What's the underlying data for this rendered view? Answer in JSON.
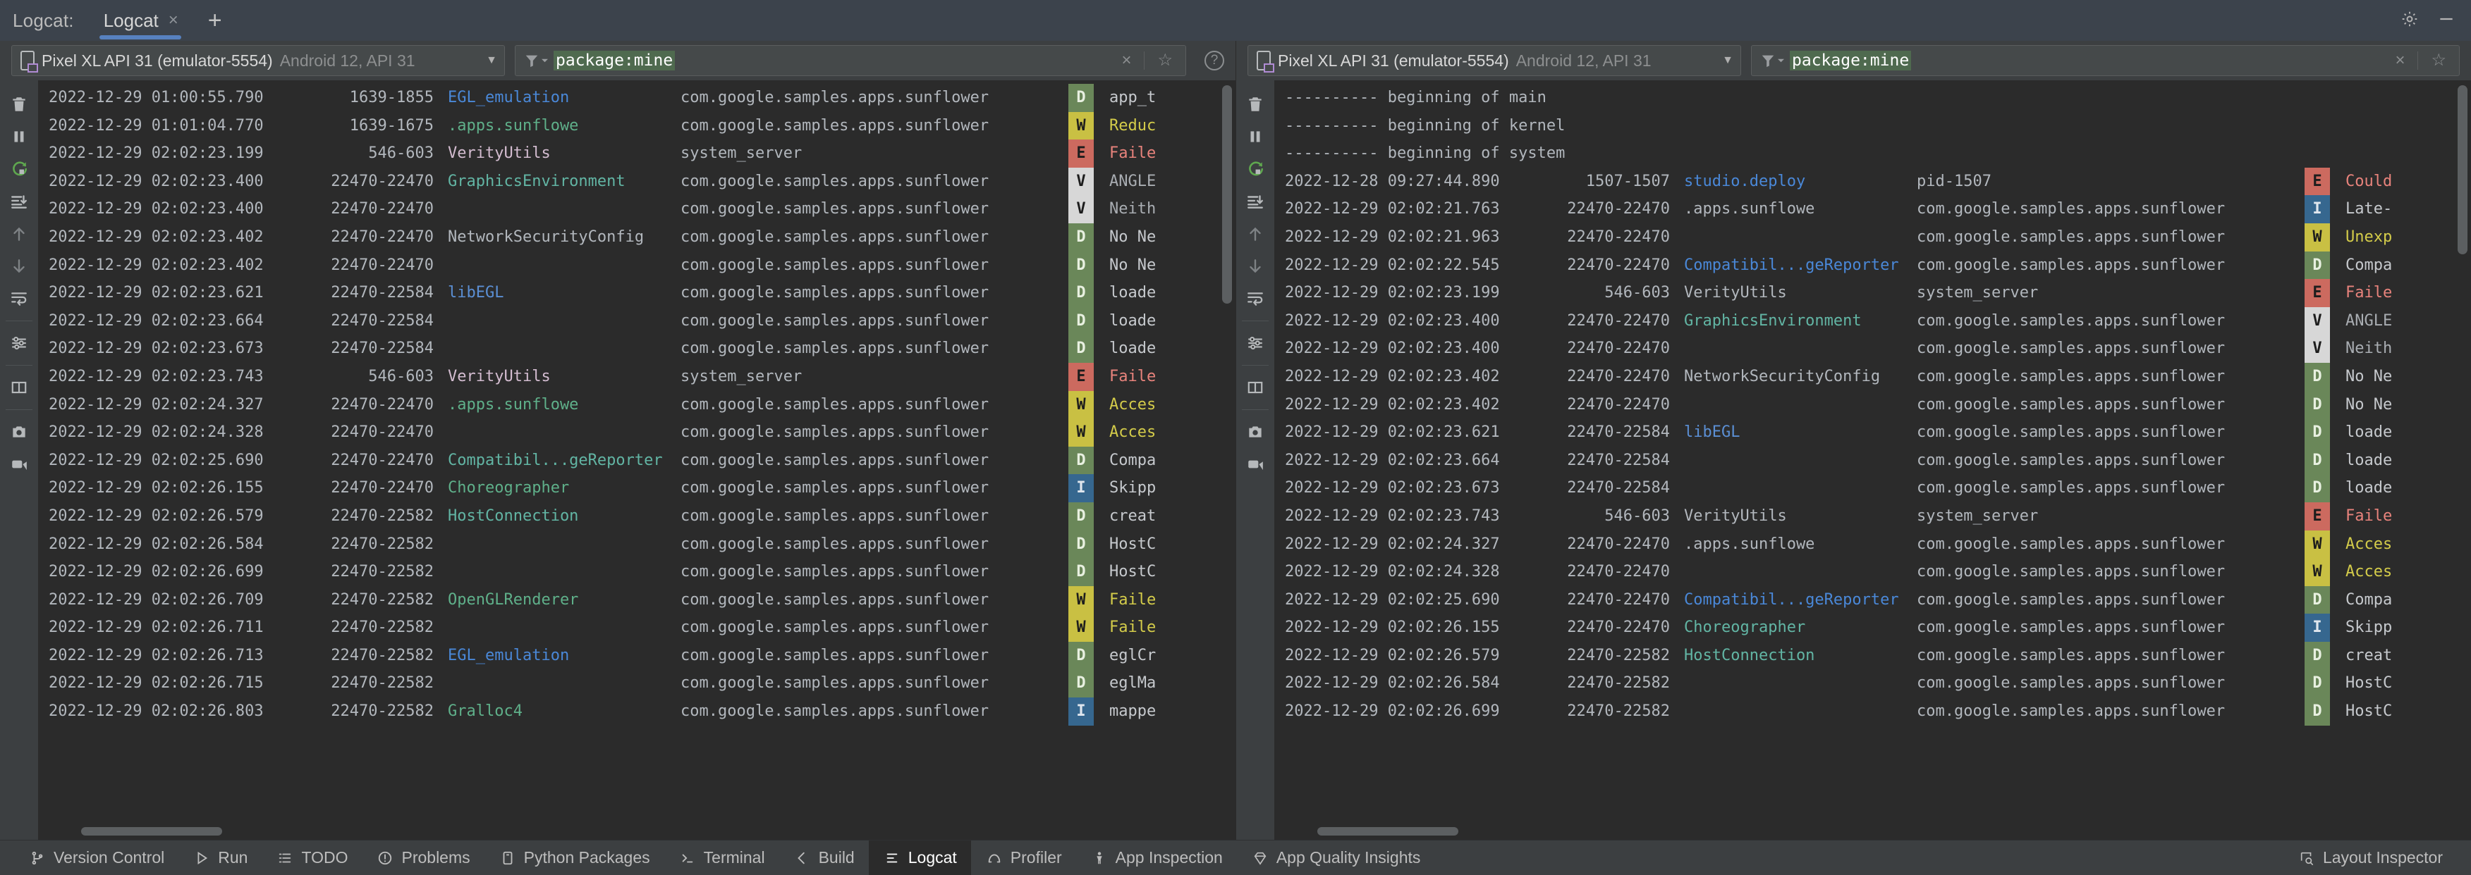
{
  "window": {
    "tab_label": "Logcat:",
    "tabs": [
      {
        "title": "Logcat",
        "close": "×",
        "active": true
      }
    ],
    "add_tab": "+",
    "settings_icon": "gear-icon",
    "minimize_icon": "minimize-icon"
  },
  "panels": [
    {
      "id": "left",
      "device": {
        "name": "Pixel XL API 31 (emulator-5554)",
        "meta": "Android 12, API 31",
        "caret": "▼"
      },
      "filter": {
        "query": "package:mine",
        "clear": "×",
        "favorite": "☆",
        "help": "?"
      },
      "toolbar": [
        "clear-logcat-icon",
        "pause-icon",
        "restart-icon",
        "scroll-to-end-icon",
        "previous-icon",
        "next-icon",
        "soft-wrap-icon",
        "configure-icon",
        "split-panels-icon",
        "screenshot-icon",
        "screen-record-icon"
      ],
      "rows": [
        {
          "ts": "2022-12-29 01:00:55.790",
          "pid": "1639-1855",
          "tag": "EGL_emulation",
          "tagcolor": "tag-blue",
          "pkg": "com.google.samples.apps.sunflower",
          "level": "D",
          "msg": "app_t"
        },
        {
          "ts": "2022-12-29 01:01:04.770",
          "pid": "1639-1675",
          "tag": ".apps.sunflowe",
          "tagcolor": "tag-green",
          "pkg": "com.google.samples.apps.sunflower",
          "level": "W",
          "msg": "Reduc"
        },
        {
          "ts": "2022-12-29 02:02:23.199",
          "pid": "546-603",
          "tag": "VerityUtils",
          "tagcolor": "tag-pink",
          "pkg": "system_server",
          "level": "E",
          "msg": "Faile"
        },
        {
          "ts": "2022-12-29 02:02:23.400",
          "pid": "22470-22470",
          "tag": "GraphicsEnvironment",
          "tagcolor": "tag-teal",
          "pkg": "com.google.samples.apps.sunflower",
          "level": "V",
          "msg": "ANGLE"
        },
        {
          "ts": "2022-12-29 02:02:23.400",
          "pid": "22470-22470",
          "tag": "",
          "tagcolor": "tag-gray",
          "pkg": "com.google.samples.apps.sunflower",
          "level": "V",
          "msg": "Neith"
        },
        {
          "ts": "2022-12-29 02:02:23.402",
          "pid": "22470-22470",
          "tag": "NetworkSecurityConfig",
          "tagcolor": "tag-gray",
          "pkg": "com.google.samples.apps.sunflower",
          "level": "D",
          "msg": "No Ne"
        },
        {
          "ts": "2022-12-29 02:02:23.402",
          "pid": "22470-22470",
          "tag": "",
          "tagcolor": "tag-gray",
          "pkg": "com.google.samples.apps.sunflower",
          "level": "D",
          "msg": "No Ne"
        },
        {
          "ts": "2022-12-29 02:02:23.621",
          "pid": "22470-22584",
          "tag": "libEGL",
          "tagcolor": "tag-sky",
          "pkg": "com.google.samples.apps.sunflower",
          "level": "D",
          "msg": "loade"
        },
        {
          "ts": "2022-12-29 02:02:23.664",
          "pid": "22470-22584",
          "tag": "",
          "tagcolor": "tag-gray",
          "pkg": "com.google.samples.apps.sunflower",
          "level": "D",
          "msg": "loade"
        },
        {
          "ts": "2022-12-29 02:02:23.673",
          "pid": "22470-22584",
          "tag": "",
          "tagcolor": "tag-gray",
          "pkg": "com.google.samples.apps.sunflower",
          "level": "D",
          "msg": "loade"
        },
        {
          "ts": "2022-12-29 02:02:23.743",
          "pid": "546-603",
          "tag": "VerityUtils",
          "tagcolor": "tag-pink",
          "pkg": "system_server",
          "level": "E",
          "msg": "Faile"
        },
        {
          "ts": "2022-12-29 02:02:24.327",
          "pid": "22470-22470",
          "tag": ".apps.sunflowe",
          "tagcolor": "tag-green",
          "pkg": "com.google.samples.apps.sunflower",
          "level": "W",
          "msg": "Acces"
        },
        {
          "ts": "2022-12-29 02:02:24.328",
          "pid": "22470-22470",
          "tag": "",
          "tagcolor": "tag-gray",
          "pkg": "com.google.samples.apps.sunflower",
          "level": "W",
          "msg": "Acces"
        },
        {
          "ts": "2022-12-29 02:02:25.690",
          "pid": "22470-22470",
          "tag": "Compatibil...geReporter",
          "tagcolor": "tag-teal",
          "pkg": "com.google.samples.apps.sunflower",
          "level": "D",
          "msg": "Compa"
        },
        {
          "ts": "2022-12-29 02:02:26.155",
          "pid": "22470-22470",
          "tag": "Choreographer",
          "tagcolor": "tag-green",
          "pkg": "com.google.samples.apps.sunflower",
          "level": "I",
          "msg": "Skipp"
        },
        {
          "ts": "2022-12-29 02:02:26.579",
          "pid": "22470-22582",
          "tag": "HostConnection",
          "tagcolor": "tag-teal",
          "pkg": "com.google.samples.apps.sunflower",
          "level": "D",
          "msg": "creat"
        },
        {
          "ts": "2022-12-29 02:02:26.584",
          "pid": "22470-22582",
          "tag": "",
          "tagcolor": "tag-gray",
          "pkg": "com.google.samples.apps.sunflower",
          "level": "D",
          "msg": "HostC"
        },
        {
          "ts": "2022-12-29 02:02:26.699",
          "pid": "22470-22582",
          "tag": "",
          "tagcolor": "tag-gray",
          "pkg": "com.google.samples.apps.sunflower",
          "level": "D",
          "msg": "HostC"
        },
        {
          "ts": "2022-12-29 02:02:26.709",
          "pid": "22470-22582",
          "tag": "OpenGLRenderer",
          "tagcolor": "tag-green",
          "pkg": "com.google.samples.apps.sunflower",
          "level": "W",
          "msg": "Faile"
        },
        {
          "ts": "2022-12-29 02:02:26.711",
          "pid": "22470-22582",
          "tag": "",
          "tagcolor": "tag-gray",
          "pkg": "com.google.samples.apps.sunflower",
          "level": "W",
          "msg": "Faile"
        },
        {
          "ts": "2022-12-29 02:02:26.713",
          "pid": "22470-22582",
          "tag": "EGL_emulation",
          "tagcolor": "tag-blue",
          "pkg": "com.google.samples.apps.sunflower",
          "level": "D",
          "msg": "eglCr"
        },
        {
          "ts": "2022-12-29 02:02:26.715",
          "pid": "22470-22582",
          "tag": "",
          "tagcolor": "tag-gray",
          "pkg": "com.google.samples.apps.sunflower",
          "level": "D",
          "msg": "eglMa"
        },
        {
          "ts": "2022-12-29 02:02:26.803",
          "pid": "22470-22582",
          "tag": "Gralloc4",
          "tagcolor": "tag-green",
          "pkg": "com.google.samples.apps.sunflower",
          "level": "I",
          "msg": "mappe"
        }
      ]
    },
    {
      "id": "right",
      "device": {
        "name": "Pixel XL API 31 (emulator-5554)",
        "meta": "Android 12, API 31",
        "caret": "▼"
      },
      "filter": {
        "query": "package:mine",
        "clear": "×",
        "favorite": "☆",
        "help": "?"
      },
      "toolbar": [
        "clear-logcat-icon",
        "pause-icon",
        "restart-icon",
        "scroll-to-end-icon",
        "previous-icon",
        "next-icon",
        "soft-wrap-icon",
        "configure-icon",
        "split-panels-icon",
        "screenshot-icon",
        "screen-record-icon"
      ],
      "rows": [
        {
          "separator": "---------- beginning of main"
        },
        {
          "separator": "---------- beginning of kernel"
        },
        {
          "separator": "---------- beginning of system"
        },
        {
          "ts": "2022-12-28 09:27:44.890",
          "pid": "1507-1507",
          "tag": "studio.deploy",
          "tagcolor": "tag-blue",
          "pkg": "pid-1507",
          "level": "E",
          "msg": "Could"
        },
        {
          "ts": "2022-12-29 02:02:21.763",
          "pid": "22470-22470",
          "tag": ".apps.sunflowe",
          "tagcolor": "tag-gray",
          "pkg": "com.google.samples.apps.sunflower",
          "level": "I",
          "msg": "Late-"
        },
        {
          "ts": "2022-12-29 02:02:21.963",
          "pid": "22470-22470",
          "tag": "",
          "tagcolor": "tag-gray",
          "pkg": "com.google.samples.apps.sunflower",
          "level": "W",
          "msg": "Unexp"
        },
        {
          "ts": "2022-12-29 02:02:22.545",
          "pid": "22470-22470",
          "tag": "Compatibil...geReporter",
          "tagcolor": "tag-blue",
          "pkg": "com.google.samples.apps.sunflower",
          "level": "D",
          "msg": "Compa"
        },
        {
          "ts": "2022-12-29 02:02:23.199",
          "pid": "546-603",
          "tag": "VerityUtils",
          "tagcolor": "tag-gray",
          "pkg": "system_server",
          "level": "E",
          "msg": "Faile"
        },
        {
          "ts": "2022-12-29 02:02:23.400",
          "pid": "22470-22470",
          "tag": "GraphicsEnvironment",
          "tagcolor": "tag-teal",
          "pkg": "com.google.samples.apps.sunflower",
          "level": "V",
          "msg": "ANGLE"
        },
        {
          "ts": "2022-12-29 02:02:23.400",
          "pid": "22470-22470",
          "tag": "",
          "tagcolor": "tag-gray",
          "pkg": "com.google.samples.apps.sunflower",
          "level": "V",
          "msg": "Neith"
        },
        {
          "ts": "2022-12-29 02:02:23.402",
          "pid": "22470-22470",
          "tag": "NetworkSecurityConfig",
          "tagcolor": "tag-gray",
          "pkg": "com.google.samples.apps.sunflower",
          "level": "D",
          "msg": "No Ne"
        },
        {
          "ts": "2022-12-29 02:02:23.402",
          "pid": "22470-22470",
          "tag": "",
          "tagcolor": "tag-gray",
          "pkg": "com.google.samples.apps.sunflower",
          "level": "D",
          "msg": "No Ne"
        },
        {
          "ts": "2022-12-29 02:02:23.621",
          "pid": "22470-22584",
          "tag": "libEGL",
          "tagcolor": "tag-sky",
          "pkg": "com.google.samples.apps.sunflower",
          "level": "D",
          "msg": "loade"
        },
        {
          "ts": "2022-12-29 02:02:23.664",
          "pid": "22470-22584",
          "tag": "",
          "tagcolor": "tag-gray",
          "pkg": "com.google.samples.apps.sunflower",
          "level": "D",
          "msg": "loade"
        },
        {
          "ts": "2022-12-29 02:02:23.673",
          "pid": "22470-22584",
          "tag": "",
          "tagcolor": "tag-gray",
          "pkg": "com.google.samples.apps.sunflower",
          "level": "D",
          "msg": "loade"
        },
        {
          "ts": "2022-12-29 02:02:23.743",
          "pid": "546-603",
          "tag": "VerityUtils",
          "tagcolor": "tag-gray",
          "pkg": "system_server",
          "level": "E",
          "msg": "Faile"
        },
        {
          "ts": "2022-12-29 02:02:24.327",
          "pid": "22470-22470",
          "tag": ".apps.sunflowe",
          "tagcolor": "tag-gray",
          "pkg": "com.google.samples.apps.sunflower",
          "level": "W",
          "msg": "Acces"
        },
        {
          "ts": "2022-12-29 02:02:24.328",
          "pid": "22470-22470",
          "tag": "",
          "tagcolor": "tag-gray",
          "pkg": "com.google.samples.apps.sunflower",
          "level": "W",
          "msg": "Acces"
        },
        {
          "ts": "2022-12-29 02:02:25.690",
          "pid": "22470-22470",
          "tag": "Compatibil...geReporter",
          "tagcolor": "tag-blue",
          "pkg": "com.google.samples.apps.sunflower",
          "level": "D",
          "msg": "Compa"
        },
        {
          "ts": "2022-12-29 02:02:26.155",
          "pid": "22470-22470",
          "tag": "Choreographer",
          "tagcolor": "tag-teal",
          "pkg": "com.google.samples.apps.sunflower",
          "level": "I",
          "msg": "Skipp"
        },
        {
          "ts": "2022-12-29 02:02:26.579",
          "pid": "22470-22582",
          "tag": "HostConnection",
          "tagcolor": "tag-teal",
          "pkg": "com.google.samples.apps.sunflower",
          "level": "D",
          "msg": "creat"
        },
        {
          "ts": "2022-12-29 02:02:26.584",
          "pid": "22470-22582",
          "tag": "",
          "tagcolor": "tag-gray",
          "pkg": "com.google.samples.apps.sunflower",
          "level": "D",
          "msg": "HostC"
        },
        {
          "ts": "2022-12-29 02:02:26.699",
          "pid": "22470-22582",
          "tag": "",
          "tagcolor": "tag-gray",
          "pkg": "com.google.samples.apps.sunflower",
          "level": "D",
          "msg": "HostC"
        }
      ]
    }
  ],
  "statusbar": {
    "items": [
      {
        "label": "Version Control",
        "icon": "branch-icon",
        "active": false
      },
      {
        "label": "Run",
        "icon": "play-icon",
        "active": false
      },
      {
        "label": "TODO",
        "icon": "list-icon",
        "active": false
      },
      {
        "label": "Problems",
        "icon": "warning-icon",
        "active": false
      },
      {
        "label": "Python Packages",
        "icon": "package-icon",
        "active": false
      },
      {
        "label": "Terminal",
        "icon": "terminal-icon",
        "active": false
      },
      {
        "label": "Build",
        "icon": "hammer-icon",
        "active": false
      },
      {
        "label": "Logcat",
        "icon": "logcat-icon",
        "active": true
      },
      {
        "label": "Profiler",
        "icon": "profiler-icon",
        "active": false
      },
      {
        "label": "App Inspection",
        "icon": "inspection-icon",
        "active": false
      },
      {
        "label": "App Quality Insights",
        "icon": "diamond-icon",
        "active": false
      }
    ],
    "right": {
      "label": "Layout Inspector",
      "icon": "layout-inspector-icon"
    }
  },
  "colors": {
    "accent": "#5781bf",
    "level_d": "#6a8759",
    "level_w": "#c9c043",
    "level_e": "#cc6a5f",
    "level_i": "#36678f",
    "level_v": "#d7d7d7",
    "filter_highlight": "#4f6a4f",
    "editor_bg": "#2b2b2b",
    "chrome_bg": "#3c3f41"
  }
}
